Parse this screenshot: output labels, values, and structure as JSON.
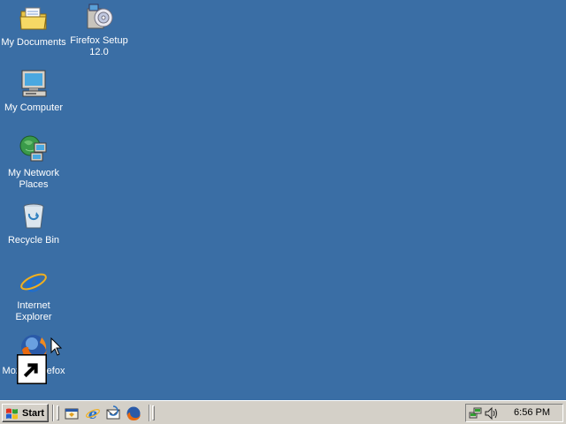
{
  "desktop": {
    "background_color": "#3a6ea5",
    "icons": [
      {
        "label": "My Documents",
        "icon": "folder-documents-icon"
      },
      {
        "label": "Firefox Setup\n12.0",
        "icon": "installer-package-icon"
      },
      {
        "label": "My Computer",
        "icon": "computer-monitor-icon"
      },
      {
        "label": "My Network\nPlaces",
        "icon": "network-places-icon"
      },
      {
        "label": "Recycle Bin",
        "icon": "recycle-bin-icon"
      },
      {
        "label": "Internet\nExplorer",
        "icon": "internet-explorer-icon"
      },
      {
        "label": "Mozilla Firefox",
        "icon": "firefox-icon"
      }
    ]
  },
  "taskbar": {
    "start_label": "Start",
    "quick_launch": [
      {
        "icon": "show-desktop-icon"
      },
      {
        "icon": "internet-explorer-icon"
      },
      {
        "icon": "outlook-express-icon"
      },
      {
        "icon": "firefox-icon"
      }
    ],
    "tray": {
      "icons": [
        "network-connection-icon",
        "volume-icon"
      ],
      "clock": "6:56 PM"
    }
  }
}
